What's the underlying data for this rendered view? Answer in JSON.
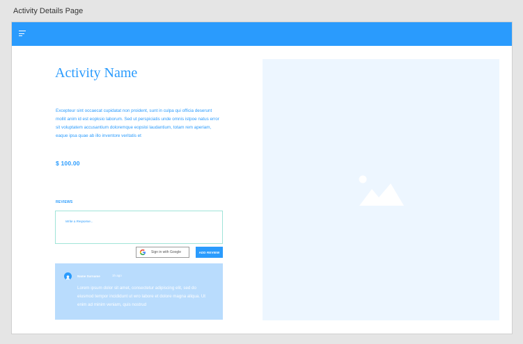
{
  "frame": {
    "title": "Activity Details Page"
  },
  "topbar": {
    "menu_icon": "menu-icon",
    "color": "#2a9bfd"
  },
  "activity": {
    "name": "Activity Name",
    "description": "Excepteur sint occaecat cupidatat non proident, sunt in culpa qui officia deserunt mollit anim id est eopksio laborum. Sed ut perspiciatis unde omnis istpoe natus error sit voluptatem accusantium doloremque eopsloi laudantium, totam rem aperiam, eaque ipsa quae ab illo inventore veritatis et",
    "price": "$ 100.00",
    "image_icon": "image-placeholder-icon"
  },
  "reviews": {
    "heading": "REVIEWS",
    "input_placeholder": "Write a Response...",
    "google_button_label": "Sign in with Google",
    "add_review_label": "ADD REVIEW",
    "items": [
      {
        "avatar_icon": "user-avatar-icon",
        "name": "Name Surname",
        "time": "1h ago",
        "text": "Lorem ipsum dolor sit amet, consectetur adipiscing elit, sed do eiusmod tempor incididunt ut wro labore et dolore magna aliqua. Ut enim ad minim veniam, quis nostrud"
      }
    ]
  },
  "colors": {
    "accent": "#2a9bfd",
    "review_card": "#b9dcfd",
    "image_background": "#edf6ff",
    "input_border": "#9fe4d8"
  }
}
